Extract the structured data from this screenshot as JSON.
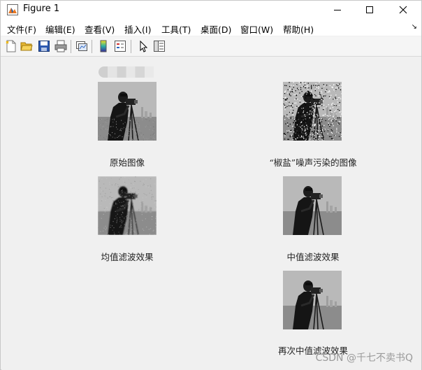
{
  "window": {
    "title": "Figure 1"
  },
  "window_controls": {
    "minimize": "—",
    "maximize": "☐",
    "close": "✕"
  },
  "menubar": {
    "items": [
      {
        "label": "文件(F)",
        "name": "menu-file"
      },
      {
        "label": "编辑(E)",
        "name": "menu-edit"
      },
      {
        "label": "查看(V)",
        "name": "menu-view"
      },
      {
        "label": "插入(I)",
        "name": "menu-insert"
      },
      {
        "label": "工具(T)",
        "name": "menu-tools"
      },
      {
        "label": "桌面(D)",
        "name": "menu-desktop"
      },
      {
        "label": "窗口(W)",
        "name": "menu-window"
      },
      {
        "label": "帮助(H)",
        "name": "menu-help"
      }
    ],
    "dock_arrow": "↘"
  },
  "toolbar": {
    "buttons": [
      "new-figure-icon",
      "open-folder-icon",
      "save-icon",
      "print-icon",
      "link-plot-icon",
      "insert-colorbar-icon",
      "insert-legend-icon",
      "edit-plot-pointer-icon",
      "property-inspector-icon"
    ]
  },
  "figure": {
    "panels": [
      {
        "caption": "原始图像",
        "variant": "original"
      },
      {
        "caption": "“椒盐”噪声污染的图像",
        "variant": "salt-pepper"
      },
      {
        "caption": "均值滤波效果",
        "variant": "mean"
      },
      {
        "caption": "中值滤波效果",
        "variant": "median"
      },
      {
        "caption": "再次中值滤波效果",
        "variant": "median2"
      }
    ]
  },
  "watermark": "CSDN @千七不卖书Q"
}
